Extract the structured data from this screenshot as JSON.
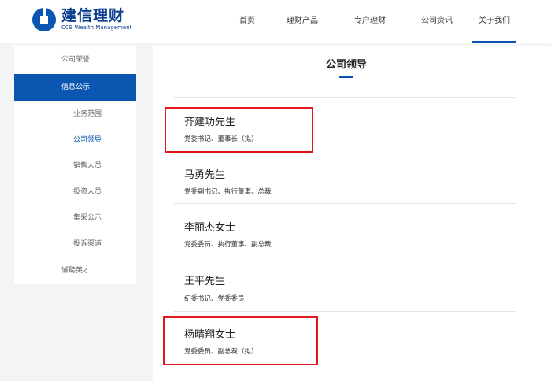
{
  "brand": {
    "name_cn": "建信理财",
    "name_en": "CCB Wealth Management"
  },
  "nav": [
    {
      "label": "首页"
    },
    {
      "label": "理财产品"
    },
    {
      "label": "专户理财"
    },
    {
      "label": "公司资讯"
    },
    {
      "label": "关于我们"
    }
  ],
  "sidebar": [
    {
      "label": "公司荣誉"
    },
    {
      "label": "信息公示"
    },
    {
      "label": "业务范围"
    },
    {
      "label": "公司领导"
    },
    {
      "label": "销售人员"
    },
    {
      "label": "投资人员"
    },
    {
      "label": "集采公示"
    },
    {
      "label": "投诉渠道"
    },
    {
      "label": "诚聘英才"
    }
  ],
  "page_title": "公司领导",
  "leaders": [
    {
      "name": "齐建功先生",
      "title": "党委书记、董事长（拟）"
    },
    {
      "name": "马勇先生",
      "title": "党委副书记、执行董事、总裁"
    },
    {
      "name": "李丽杰女士",
      "title": "党委委员、执行董事、副总裁"
    },
    {
      "name": "王平先生",
      "title": "纪委书记、党委委员"
    },
    {
      "name": "杨晴翔女士",
      "title": "党委委员、副总裁（拟）"
    }
  ],
  "colors": {
    "brand_blue": "#0b56b0",
    "highlight_red": "#e4161b"
  }
}
